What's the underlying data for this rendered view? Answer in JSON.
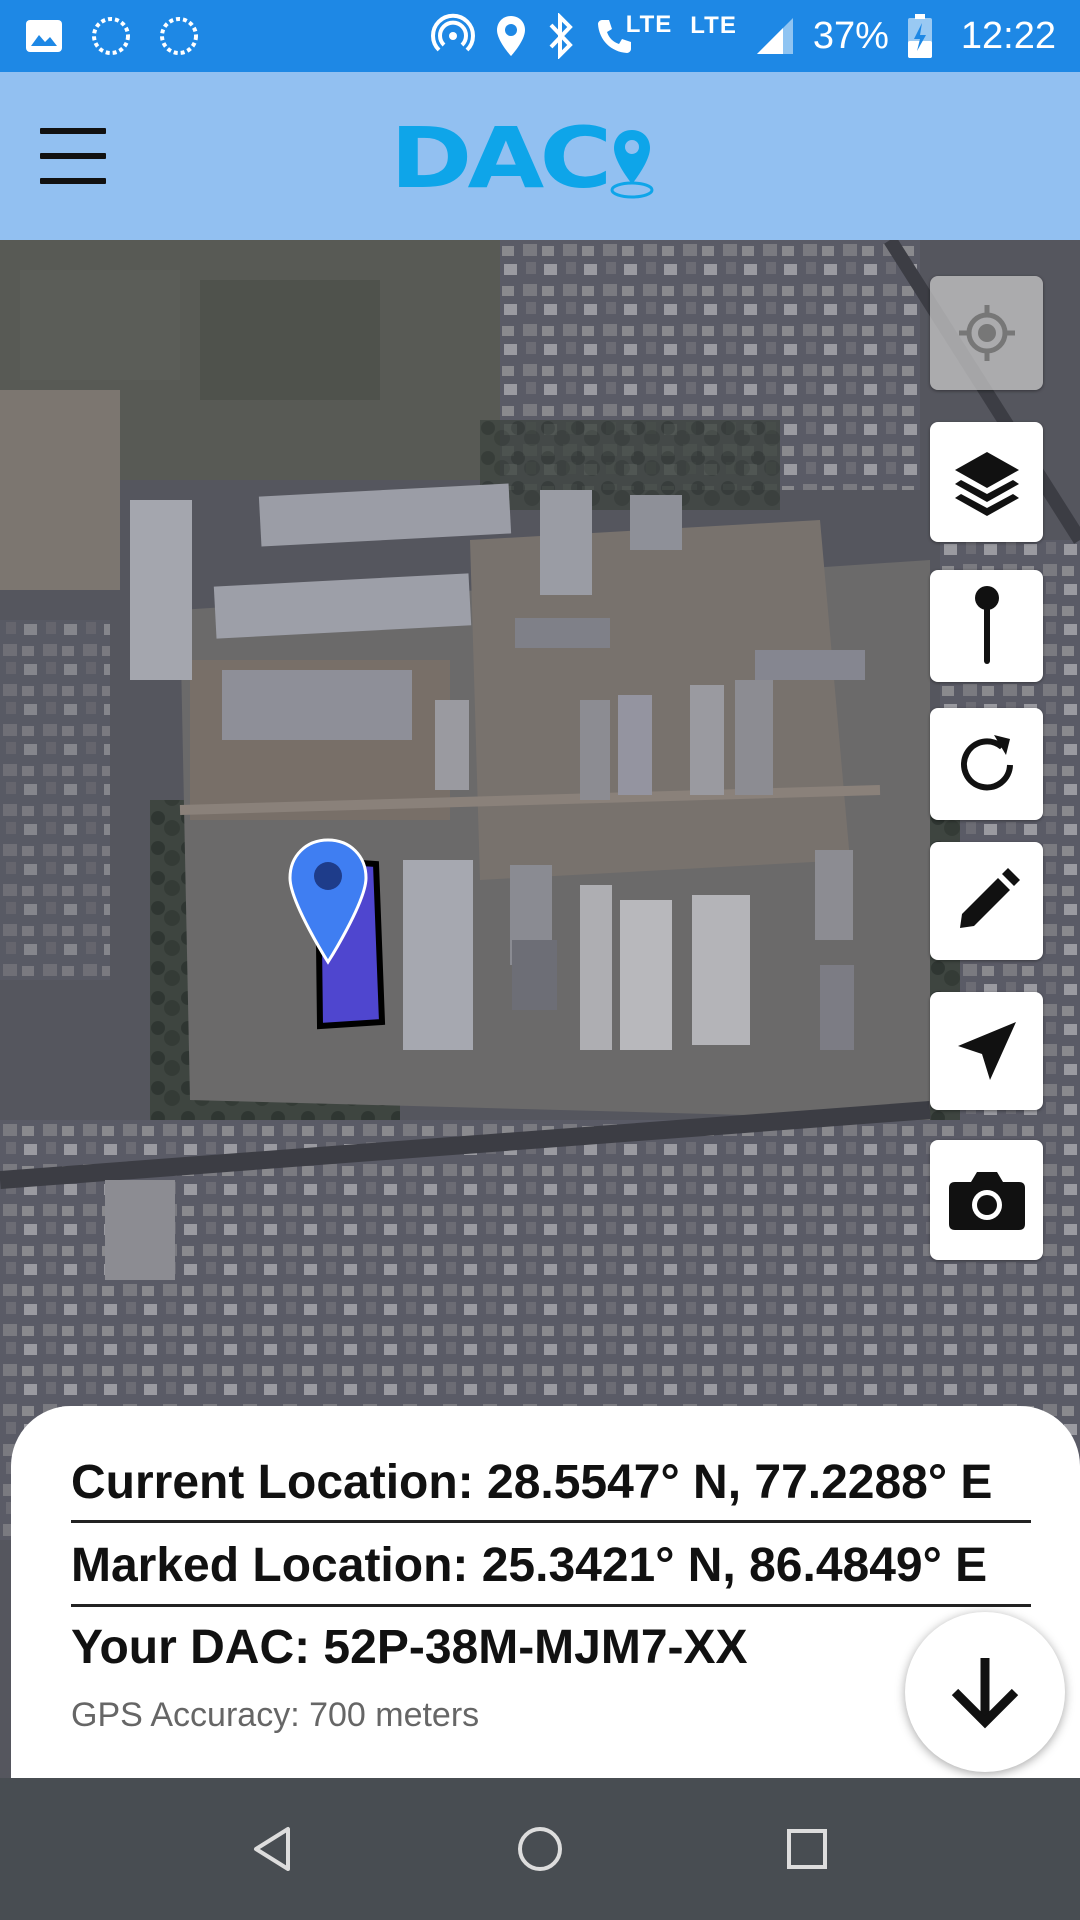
{
  "status_bar": {
    "icons_left": [
      "gallery-icon",
      "loading-icon",
      "loading-icon"
    ],
    "icons_right": [
      "hotspot-icon",
      "location-icon",
      "bluetooth-icon",
      "volte-call-icon",
      "lte-signal-icon",
      "signal-icon",
      "battery-charging-icon"
    ],
    "volte_label": "LTE",
    "lte_label": "LTE",
    "battery": "37%",
    "time": "12:22"
  },
  "app_bar": {
    "logo_text": "DAC",
    "menu_icon": "hamburger-menu-icon"
  },
  "map": {
    "type": "satellite",
    "marker_icon": "map-pin-icon"
  },
  "toolbar": {
    "buttons": [
      {
        "icon": "my-location-icon"
      },
      {
        "icon": "layers-icon"
      },
      {
        "icon": "pin-icon"
      },
      {
        "icon": "refresh-icon"
      },
      {
        "icon": "pencil-icon"
      },
      {
        "icon": "navigation-icon"
      },
      {
        "icon": "camera-icon"
      }
    ]
  },
  "info": {
    "current_location": "Current Location: 28.5547° N, 77.2288° E",
    "marked_location": "Marked Location: 25.3421° N, 86.4849° E",
    "dac": "Your DAC: 52P-38M-MJM7-XX",
    "accuracy": "GPS Accuracy: 700 meters"
  },
  "fab": {
    "icon": "arrow-down-icon"
  },
  "nav_bar": {
    "buttons": [
      "back-icon",
      "home-icon",
      "recents-icon"
    ]
  },
  "colors": {
    "status_bar": "#1e88e5",
    "app_bar": "#92c0f1",
    "logo": "#0ea5e9",
    "marker": "#3f7ef2",
    "polygon": "#4a3fe0",
    "nav_bar": "#484d52"
  }
}
